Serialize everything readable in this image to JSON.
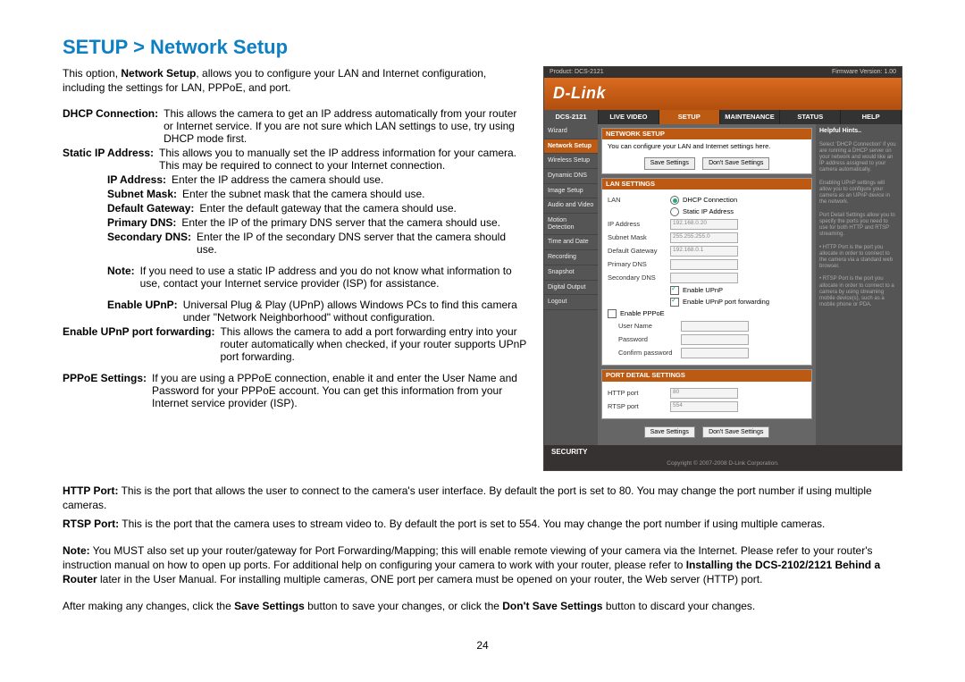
{
  "title": "SETUP > Network Setup",
  "intro_pre": "This option, ",
  "intro_bold": "Network Setup",
  "intro_post": ", allows you to configure your LAN and Internet configuration, including the settings for LAN, PPPoE, and port.",
  "defs": {
    "dhcp_l": "DHCP Connection:",
    "dhcp_v": "This allows the camera to get an IP address automatically from your router or Internet service. If you are not sure which LAN settings to use, try using DHCP mode first.",
    "static_l": "Static IP Address:",
    "static_v": "This allows you to manually set the IP address information for your camera. This may be required to connect to your Internet connection.",
    "ip_l": "IP Address:",
    "ip_v": "Enter the IP address the camera should use.",
    "mask_l": "Subnet Mask:",
    "mask_v": "Enter the subnet mask that the camera should use.",
    "gw_l": "Default Gateway:",
    "gw_v": "Enter the default gateway that the camera should use.",
    "pdns_l": "Primary DNS:",
    "pdns_v": "Enter the IP of the primary DNS server that the camera should use.",
    "sdns_l": "Secondary DNS:",
    "sdns_v": "Enter the IP of the secondary DNS server that the camera should use.",
    "note_l": "Note:",
    "note_v": "If you need to use a static IP address and you do not know what information to use, contact your Internet service provider (ISP) for assistance.",
    "upnp_l": "Enable UPnP:",
    "upnp_v": "Universal Plug & Play (UPnP) allows Windows PCs to find this camera under \"Network Neighborhood\" without configuration.",
    "upnppf_l": "Enable UPnP port forwarding:",
    "upnppf_v": "This allows the camera to add a port forwarding entry into your router automatically when checked, if your router supports UPnP port forwarding.",
    "pppoe_l": "PPPoE Settings:",
    "pppoe_v": "If you are using a PPPoE connection, enable it and enter the User Name and Password for your PPPoE account. You can get this information from your Internet service provider (ISP)."
  },
  "full": {
    "http_l": "HTTP Port:",
    "http_v": "This is the port that allows the user to connect to the camera's user interface. By default the port is set to 80. You may change the port number if using multiple cameras.",
    "rtsp_l": "RTSP Port:",
    "rtsp_v": "This is the port that the camera uses to stream video to. By default the port is set to 554. You may change the port number if using multiple cameras.",
    "note2_l": "Note:",
    "note2_a": "You MUST also set up your router/gateway for Port Forwarding/Mapping; this will enable remote viewing of your camera via the Internet. Please refer to your router's instruction manual on how to open up ports. For additional help on configuring your camera to work with your router, please refer to ",
    "note2_b": "Installing the DCS-2102/2121 Behind a Router",
    "note2_c": " later in the User Manual. For installing multiple cameras, ONE port per camera must be opened on your router, the Web server (HTTP) port.",
    "close_a": "After making any changes, click the ",
    "close_b": "Save Settings",
    "close_c": " button to save your changes, or click the ",
    "close_d": "Don't Save Settings",
    "close_e": " button to discard your changes."
  },
  "page": "24",
  "ss": {
    "product": "Product: DCS-2121",
    "fw": "Firmware Version: 1.00",
    "brand": "D-Link",
    "model": "DCS-2121",
    "tabs": [
      "LIVE VIDEO",
      "SETUP",
      "MAINTENANCE",
      "STATUS",
      "HELP"
    ],
    "side": [
      "Wizard",
      "Network Setup",
      "Wireless Setup",
      "Dynamic DNS",
      "Image Setup",
      "Audio and Video",
      "Motion Detection",
      "Time and Date",
      "Recording",
      "Snapshot",
      "Digital Output",
      "Logout"
    ],
    "panel1_h": "NETWORK SETUP",
    "panel1_b": "You can configure your LAN and Internet settings here.",
    "save": "Save Settings",
    "dont": "Don't Save Settings",
    "panel2_h": "LAN SETTINGS",
    "lan_label": "LAN",
    "dhcp": "DHCP Connection",
    "static": "Static IP Address",
    "ip": "IP Address",
    "ip_val": "192.168.0.20",
    "mask": "Subnet Mask",
    "mask_val": "255.255.255.0",
    "gw": "Default Gateway",
    "gw_val": "192.168.0.1",
    "pdns": "Primary DNS",
    "sdns": "Secondary DNS",
    "eupnp": "Enable UPnP",
    "eupnppf": "Enable UPnP port forwarding",
    "epppoe": "Enable PPPoE",
    "un": "User Name",
    "pw": "Password",
    "cpw": "Confirm password",
    "panel3_h": "PORT DETAIL SETTINGS",
    "http": "HTTP port",
    "http_val": "80",
    "rtsp": "RTSP port",
    "rtsp_val": "554",
    "security": "SECURITY",
    "copyright": "Copyright © 2007-2008 D-Link Corporation.",
    "help_h": "Helpful Hints..",
    "help_t": "Select 'DHCP Connection' if you are running a DHCP server on your network and would like an IP address assigned to your camera automatically.\n\nEnabling UPnP settings will allow you to configure your camera as an UPnP device in the network.\n\nPort Detail Settings allow you to specify the ports you need to use for both HTTP and RTSP streaming.\n\n• HTTP Port is the port you allocate in order to connect to the camera via a standard web browser.\n\n• RTSP Port is the port you allocate in order to connect to a camera by using streaming mobile device(s), such as a mobile phone or PDA."
  }
}
